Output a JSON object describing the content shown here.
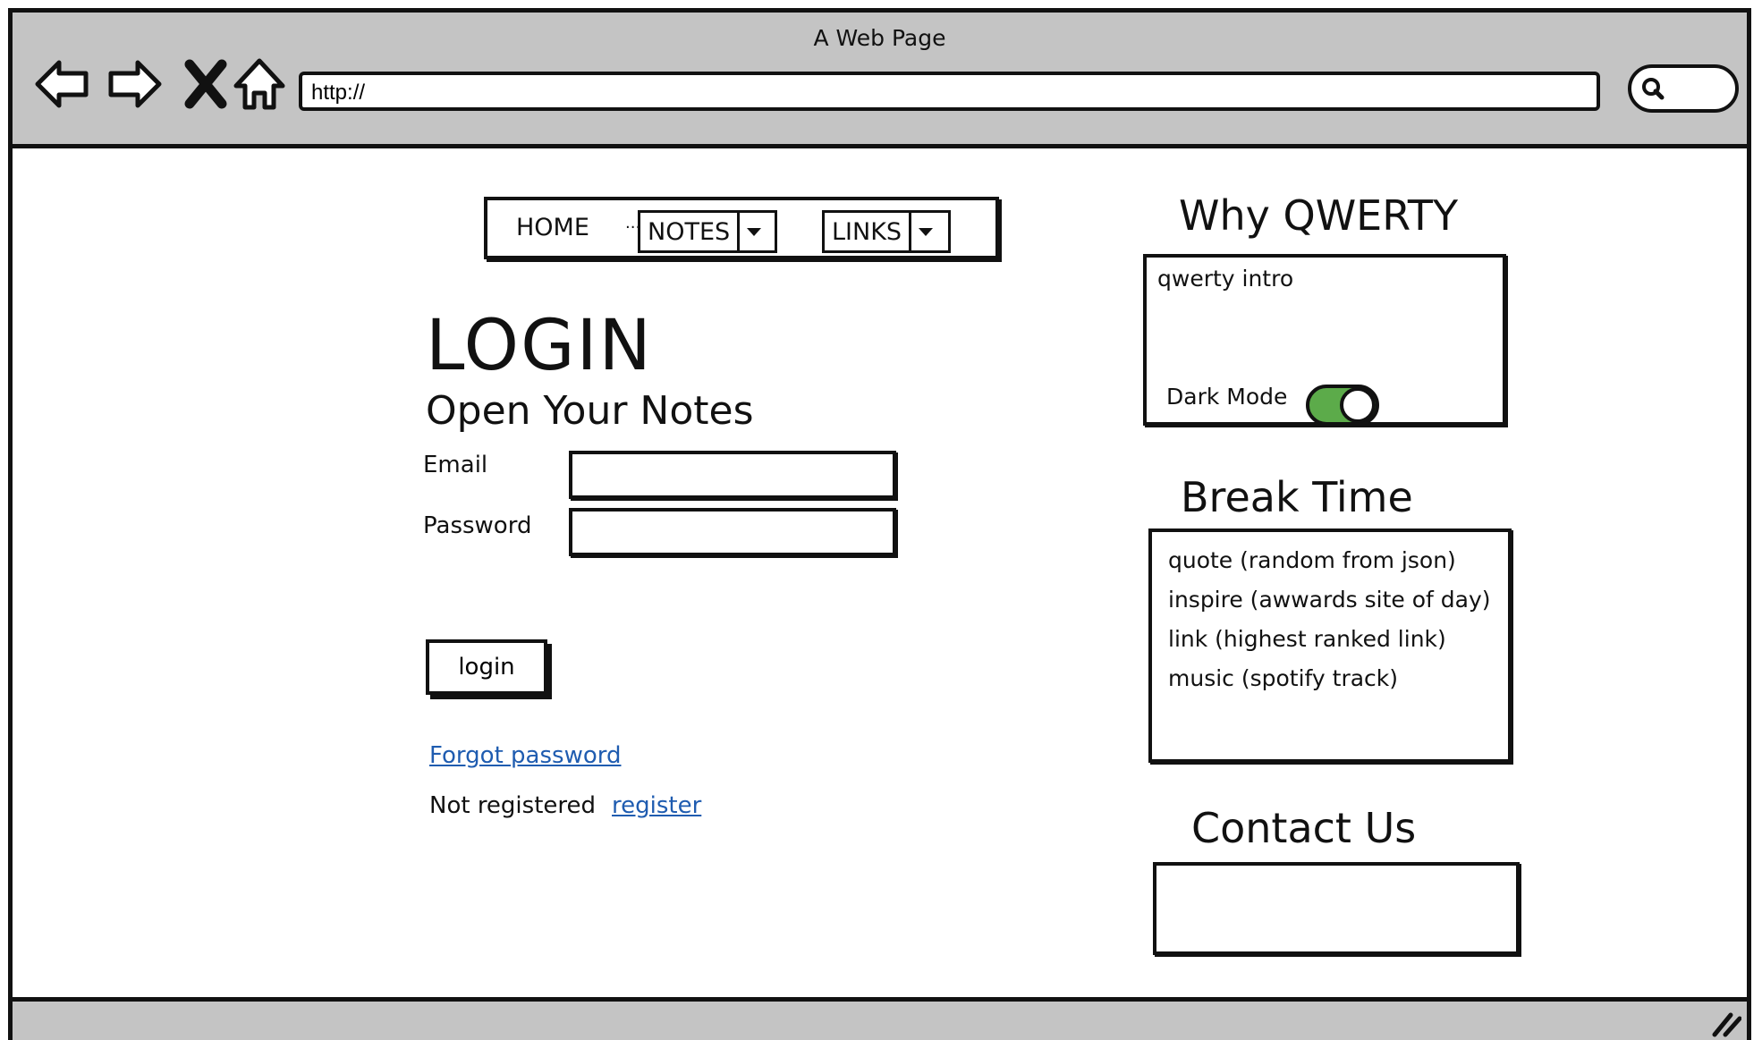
{
  "window": {
    "title": "A Web Page",
    "url": "http://"
  },
  "menu": {
    "home": "HOME",
    "separator": "...",
    "notes": "NOTES",
    "links": "LINKS"
  },
  "login": {
    "title": "LOGIN",
    "subtitle": "Open Your Notes",
    "email_label": "Email",
    "password_label": "Password",
    "email_value": "",
    "password_value": "",
    "button_label": "login",
    "forgot_link": "Forgot password",
    "not_registered": "Not registered",
    "register_link": "register"
  },
  "why": {
    "heading": "Why QWERTY",
    "intro": "qwerty intro",
    "dark_mode_label": "Dark Mode",
    "dark_mode_on": true,
    "toggle_color": "#5cab4a"
  },
  "break_time": {
    "heading": "Break Time",
    "items": [
      "quote (random from json)",
      "inspire (awwards site of day)",
      "link (highest ranked link)",
      "music (spotify track)"
    ]
  },
  "contact": {
    "heading": "Contact Us"
  },
  "colors": {
    "chrome": "#c4c4c4",
    "link": "#1f5cb0"
  },
  "icons": [
    "back-arrow-icon",
    "forward-arrow-icon",
    "stop-icon",
    "home-icon",
    "search-icon",
    "resize-grip-icon"
  ]
}
